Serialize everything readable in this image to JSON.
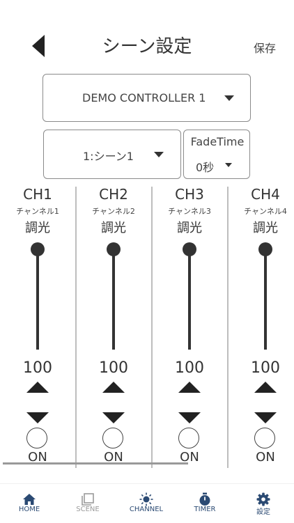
{
  "header": {
    "title": "シーン設定",
    "save_label": "保存"
  },
  "controller_select": {
    "value": "DEMO CONTROLLER 1"
  },
  "scene_select": {
    "value": "1:シーン1"
  },
  "fade_time": {
    "label": "FadeTime",
    "value": "0秒"
  },
  "channels": [
    {
      "name": "CH1",
      "sub": "チャンネル1",
      "mode": "調光",
      "value": "100",
      "state": "ON",
      "level": 1.0
    },
    {
      "name": "CH2",
      "sub": "チャンネル2",
      "mode": "調光",
      "value": "100",
      "state": "ON",
      "level": 1.0
    },
    {
      "name": "CH3",
      "sub": "チャンネル3",
      "mode": "調光",
      "value": "100",
      "state": "ON",
      "level": 1.0
    },
    {
      "name": "CH4",
      "sub": "チャンネル4",
      "mode": "調光",
      "value": "100",
      "state": "ON",
      "level": 1.0
    }
  ],
  "tabbar": {
    "items": [
      {
        "label": "HOME",
        "icon": "home-icon",
        "active": true
      },
      {
        "label": "SCENE",
        "icon": "scene-icon",
        "active": false
      },
      {
        "label": "CHANNEL",
        "icon": "channel-icon",
        "active": false
      },
      {
        "label": "TIMER",
        "icon": "timer-icon",
        "active": false
      },
      {
        "label": "設定",
        "icon": "gear-icon",
        "active": false
      }
    ]
  },
  "colors": {
    "active_tab": "#2b4a73",
    "inactive_tab": "#9a9a9a",
    "accent_tab": "#2b4a73"
  }
}
